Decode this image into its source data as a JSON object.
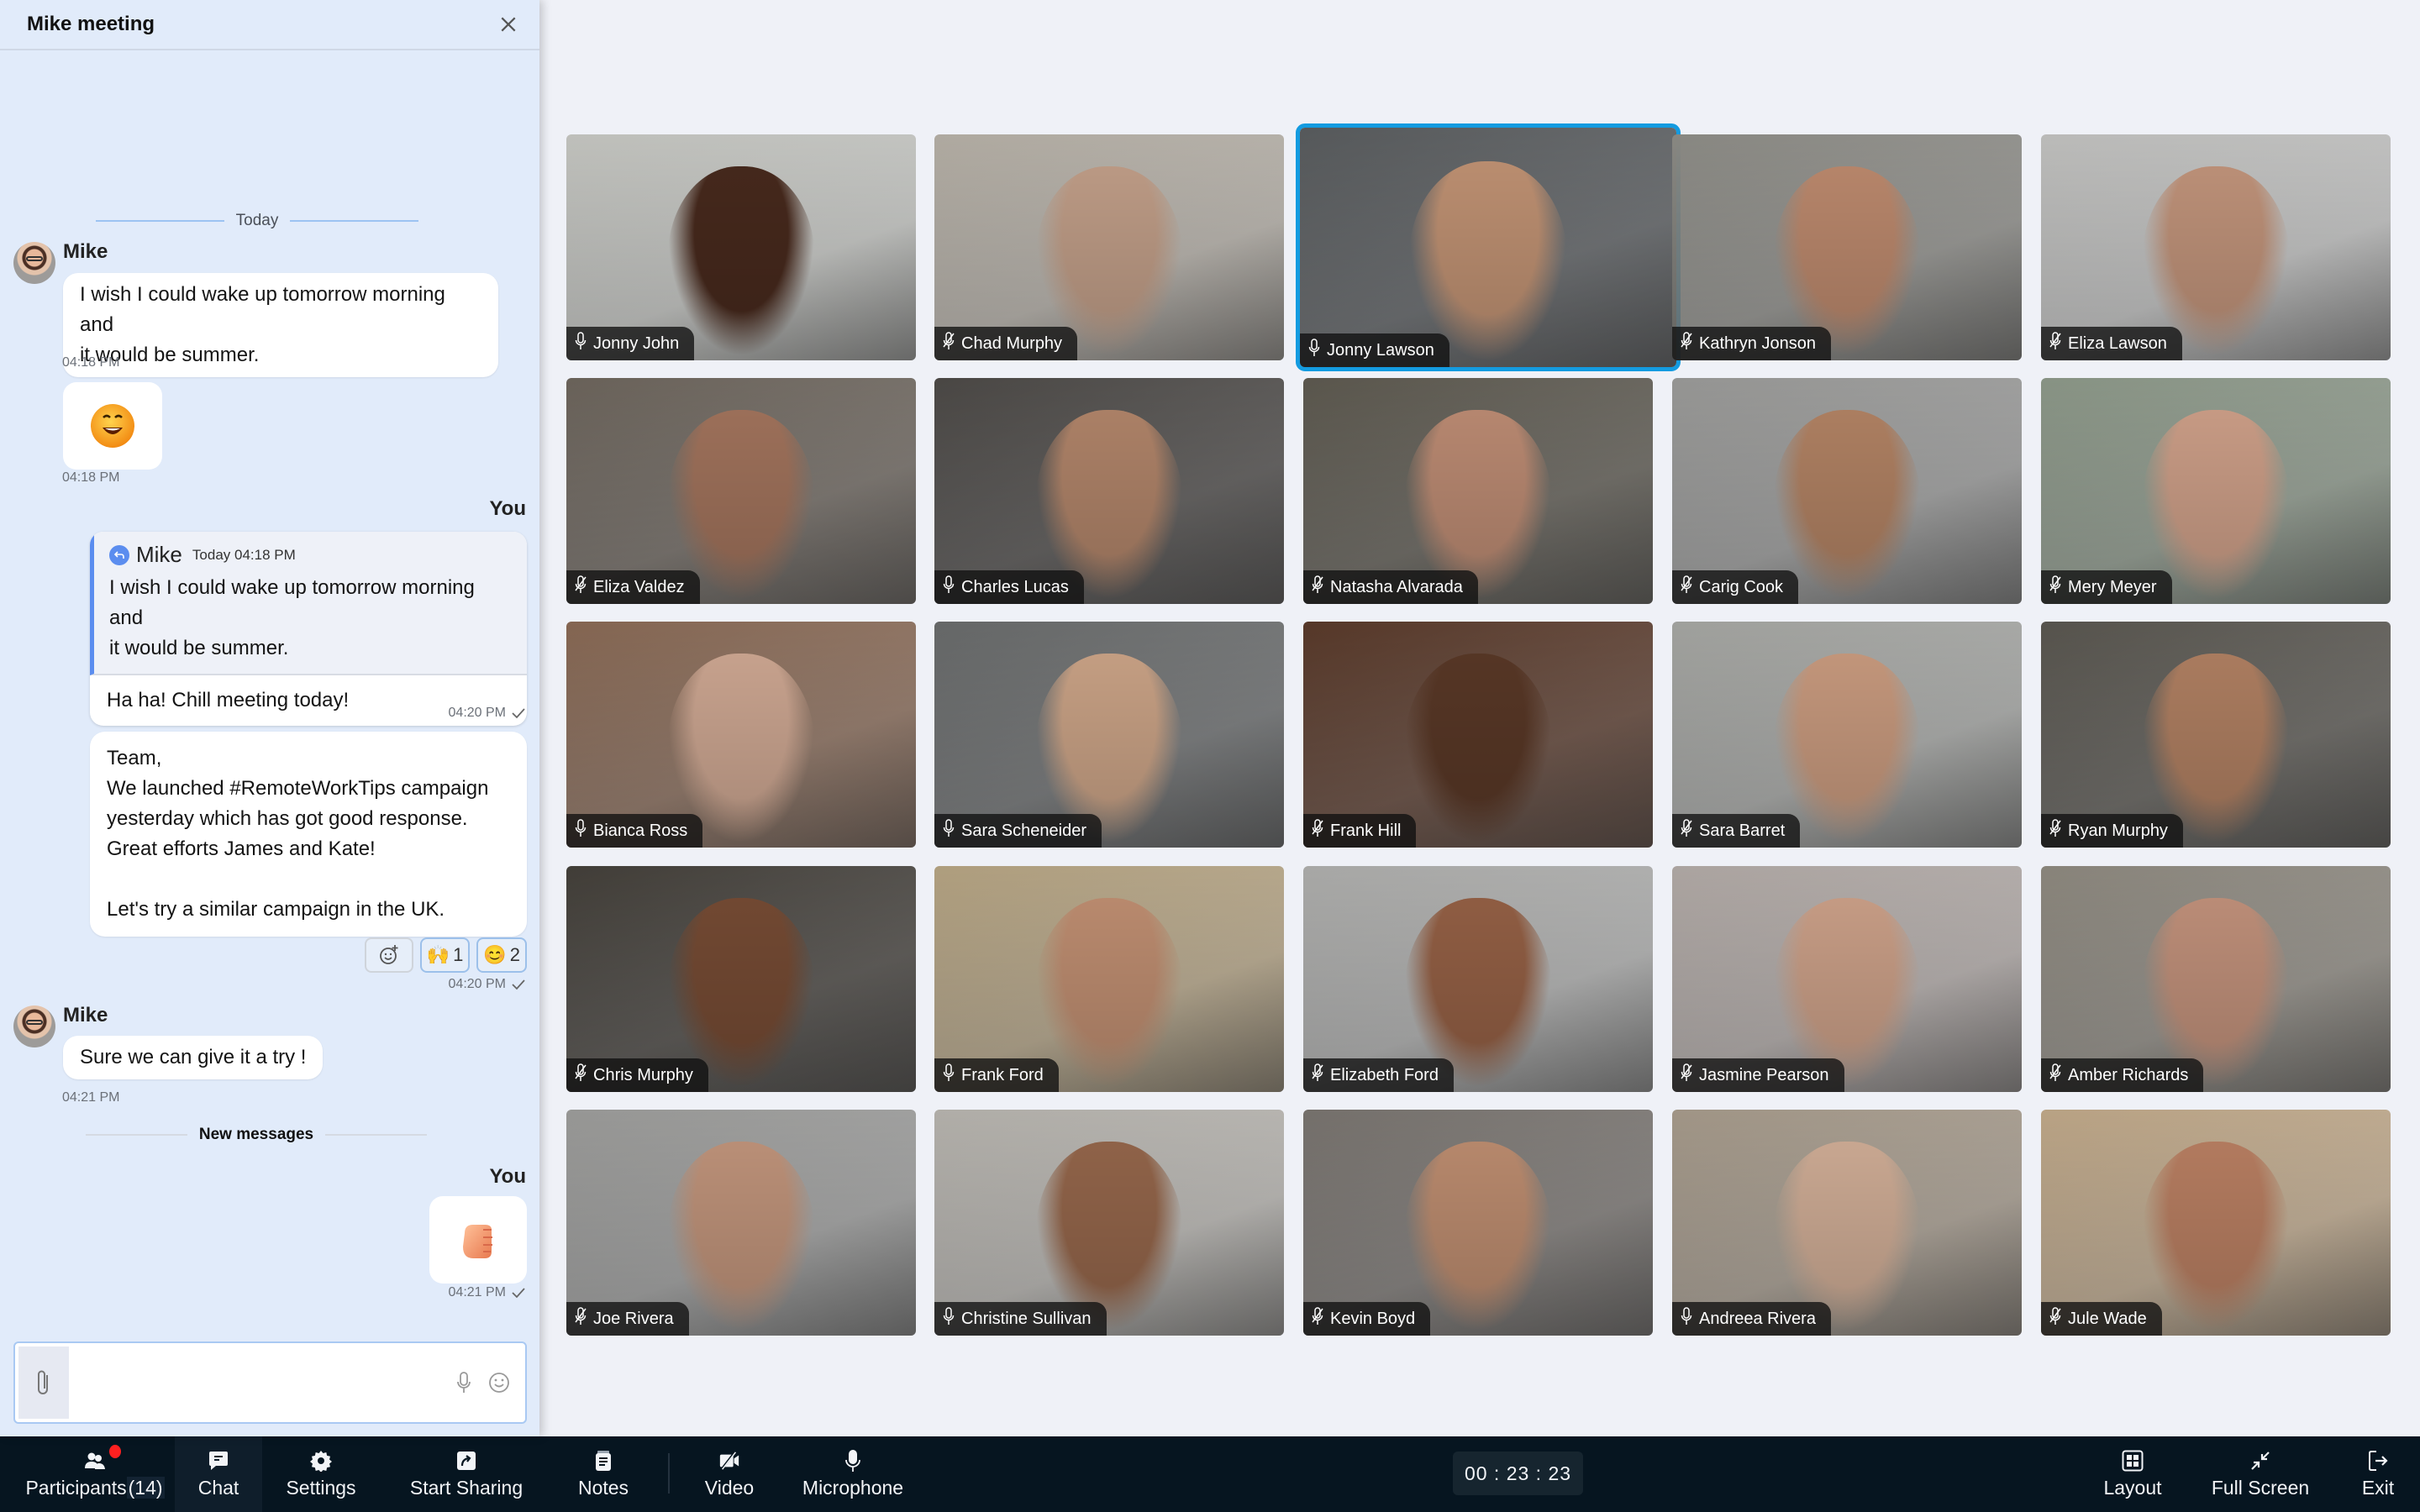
{
  "chat": {
    "title": "Mike meeting",
    "close_icon": "close-icon",
    "divider_today": "Today",
    "divider_new": "New messages",
    "messages": [
      {
        "author": "Mike",
        "text_lines": [
          "I wish I could wake up tomorrow morning and",
          "it would be summer."
        ],
        "time": "04:18 PM"
      },
      {
        "author": "Mike",
        "sticker": "😊",
        "sticker_name": "laughing-face-sticker",
        "time": "04:18 PM"
      },
      {
        "author": "You",
        "reply_to": {
          "author": "Mike",
          "when": "Today 04:18 PM",
          "text_lines": [
            "I wish I could wake up tomorrow morning and",
            "it would be summer."
          ]
        },
        "text": "Ha ha! Chill meeting today!",
        "time": "04:20 PM",
        "status": "sent-check"
      },
      {
        "author": "You",
        "text_lines": [
          "Team,",
          "We launched #RemoteWorkTips campaign",
          "yesterday which has got good response.",
          "Great efforts James and Kate!",
          "",
          "Let's try a similar campaign in the UK."
        ],
        "time": "04:20 PM",
        "status": "sent-check",
        "reactions": [
          {
            "emoji": "🙌",
            "count": "1"
          },
          {
            "emoji": "😊",
            "count": "2"
          }
        ]
      },
      {
        "author": "Mike",
        "text": "Sure we can give it a try !",
        "time": "04:21 PM"
      },
      {
        "author": "You",
        "sticker": "✊",
        "sticker_name": "fist-sticker",
        "time": "04:21 PM",
        "status": "sent-check"
      }
    ],
    "composer": {
      "placeholder": "",
      "value": ""
    }
  },
  "participants": [
    {
      "name": "Jonny John",
      "mic": "on",
      "colors": [
        "#c8c9c4",
        "#4a2b1e"
      ]
    },
    {
      "name": "Chad Murphy",
      "mic": "muted",
      "colors": [
        "#b8b2a8",
        "#c9a58e"
      ]
    },
    {
      "name": "Jonny Lawson",
      "mic": "on",
      "colors": [
        "#5a5d5f",
        "#c89878"
      ],
      "active": true
    },
    {
      "name": "Kathryn Jonson",
      "mic": "muted",
      "colors": [
        "#8f8e88",
        "#c48f72"
      ]
    },
    {
      "name": "Eliza Lawson",
      "mic": "muted",
      "colors": [
        "#c4c4c2",
        "#c99a80"
      ]
    },
    {
      "name": "Eliza Valdez",
      "mic": "muted",
      "colors": [
        "#6e665d",
        "#a87860"
      ]
    },
    {
      "name": "Charles Lucas",
      "mic": "on",
      "colors": [
        "#4d4a47",
        "#b88a6e"
      ]
    },
    {
      "name": "Natasha Alvarada",
      "mic": "muted",
      "colors": [
        "#5e5a50",
        "#c49178"
      ]
    },
    {
      "name": "Carig Cook",
      "mic": "muted",
      "colors": [
        "#9c9c9a",
        "#b98868"
      ]
    },
    {
      "name": "Mery Meyer",
      "mic": "muted",
      "colors": [
        "#8e9a8a",
        "#d6a68e"
      ]
    },
    {
      "name": "Bianca Ross",
      "mic": "on",
      "colors": [
        "#8a6a55",
        "#d6ae98"
      ]
    },
    {
      "name": "Sara Scheneider",
      "mic": "on",
      "colors": [
        "#6a6c6c",
        "#d3aa8c"
      ]
    },
    {
      "name": "Frank Hill",
      "mic": "muted",
      "colors": [
        "#5a3a2a",
        "#5c3a28"
      ]
    },
    {
      "name": "Sara Barret",
      "mic": "muted",
      "colors": [
        "#a7a8a4",
        "#d1a184"
      ]
    },
    {
      "name": "Ryan Murphy",
      "mic": "muted",
      "colors": [
        "#5a5750",
        "#b78566"
      ]
    },
    {
      "name": "Chris Murphy",
      "mic": "muted",
      "colors": [
        "#44403a",
        "#7a4e36"
      ]
    },
    {
      "name": "Frank Ford",
      "mic": "on",
      "colors": [
        "#b8a684",
        "#c79476"
      ]
    },
    {
      "name": "Elizabeth Ford",
      "mic": "muted",
      "colors": [
        "#b0b0ae",
        "#9a6448"
      ]
    },
    {
      "name": "Jasmine Pearson",
      "mic": "muted",
      "colors": [
        "#b4aca8",
        "#d4a78e"
      ]
    },
    {
      "name": "Amber Richards",
      "mic": "muted",
      "colors": [
        "#8f8a80",
        "#c99780"
      ]
    },
    {
      "name": "Joe Rivera",
      "mic": "muted",
      "colors": [
        "#9e9e9c",
        "#c89a80"
      ]
    },
    {
      "name": "Christine Sullivan",
      "mic": "on",
      "colors": [
        "#b9b6b0",
        "#9a6a4e"
      ]
    },
    {
      "name": "Kevin Boyd",
      "mic": "muted",
      "colors": [
        "#7a7570",
        "#c49274"
      ]
    },
    {
      "name": "Andreea Rivera",
      "mic": "on",
      "colors": [
        "#a89c8c",
        "#d8b49c"
      ]
    },
    {
      "name": "Jule Wade",
      "mic": "muted",
      "colors": [
        "#c2aa8a",
        "#c08466"
      ]
    }
  ],
  "toolbar": {
    "participants_label": "Participants",
    "participants_count": "(14)",
    "chat_label": "Chat",
    "settings_label": "Settings",
    "sharing_label": "Start Sharing",
    "notes_label": "Notes",
    "video_label": "Video",
    "microphone_label": "Microphone",
    "timer": "00 : 23 : 23",
    "layout_label": "Layout",
    "fullscreen_label": "Full Screen",
    "exit_label": "Exit"
  },
  "colors": {
    "accent": "#139be0",
    "reply_accent": "#5b8def",
    "notification_dot": "#ff2020",
    "chat_bg": "#e1ebfa",
    "toolbar_bg": "#061520"
  }
}
